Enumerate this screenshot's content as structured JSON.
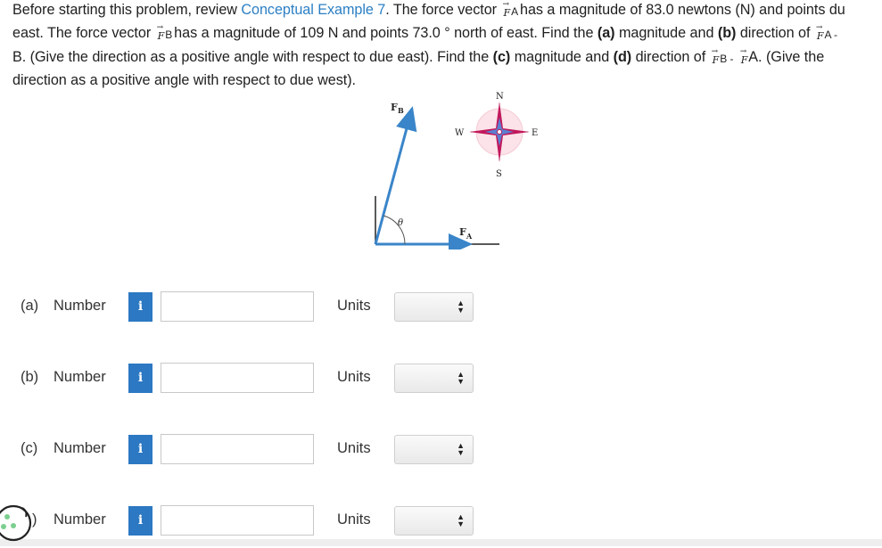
{
  "problem": {
    "line1_pre": "Before starting this problem, review ",
    "link_text": "Conceptual Example 7",
    "line1_mid": ". The force vector ",
    "vec_symbol": "F",
    "sub_A": "A",
    "sub_B": "B",
    "line1_post": "has a magnitude of 83.0 newtons (N) and points du",
    "line2_pre": "east. The force vector ",
    "line2_mid": "has a magnitude of 109 N and points 73.0 ° north of east. Find the ",
    "part_a_marker": "(a)",
    "line2_mid2": " magnitude and ",
    "part_b_marker": "(b)",
    "line2_post": " direction of ",
    "line2_end": "A - ",
    "line3_start": "B. (Give the direction as a positive angle with respect to due east). Find the ",
    "part_c_marker": "(c)",
    "line3_mid": " magnitude and ",
    "part_d_marker": "(d)",
    "line3_post": " direction of ",
    "line3_mid2": "B - ",
    "line3_end": "A. (Give the",
    "line4": "direction as a positive angle with respect to due west)."
  },
  "figure": {
    "label_FB": "F",
    "label_FB_sub": "B",
    "label_FA": "F",
    "label_FA_sub": "A",
    "angle_label": "θ",
    "compass_N": "N",
    "compass_S": "S",
    "compass_E": "E",
    "compass_W": "W"
  },
  "answers": [
    {
      "part": "(a)",
      "number_label": "Number",
      "info": "i",
      "value": "",
      "units_label": "Units",
      "units_value": ""
    },
    {
      "part": "(b)",
      "number_label": "Number",
      "info": "i",
      "value": "",
      "units_label": "Units",
      "units_value": ""
    },
    {
      "part": "(c)",
      "number_label": "Number",
      "info": "i",
      "value": "",
      "units_label": "Units",
      "units_value": ""
    },
    {
      "part": ")",
      "number_label": "Number",
      "info": "i",
      "value": "",
      "units_label": "Units",
      "units_value": ""
    }
  ],
  "colors": {
    "link": "#2b7fc4",
    "info_button": "#2c78c2",
    "vector": "#3a85c9",
    "compass_red": "#c2185b",
    "compass_blue": "#5b7fd0"
  }
}
